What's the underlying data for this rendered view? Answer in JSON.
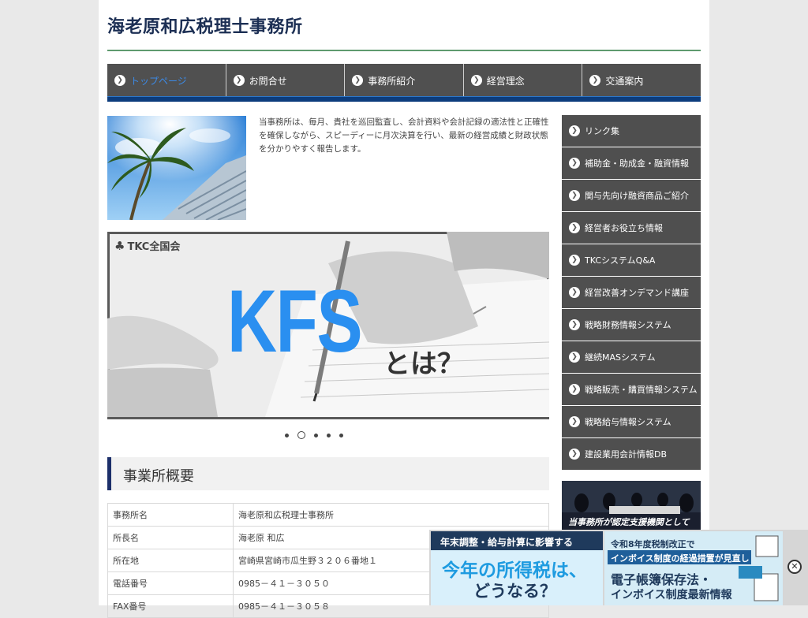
{
  "site": {
    "title": "海老原和広税理士事務所"
  },
  "nav": [
    {
      "label": "トップページ"
    },
    {
      "label": "お問合せ"
    },
    {
      "label": "事務所紹介"
    },
    {
      "label": "経営理念"
    },
    {
      "label": "交通案内"
    }
  ],
  "intro": "当事務所は、毎月、貴社を巡回監査し、会計資料や会計記録の適法性と正確性を確保しながら、スピーディーに月次決算を行い、最新の経営成績と財政状態を分かりやすく報告します。",
  "slider": {
    "logo": "TKC全国会",
    "headline": "KFS",
    "tagline": "とは？",
    "dots": 5,
    "active_dot": 2
  },
  "overview": {
    "title": "事業所概要",
    "rows": [
      {
        "label": "事務所名",
        "value": "海老原和広税理士事務所"
      },
      {
        "label": "所長名",
        "value": "海老原 和広"
      },
      {
        "label": "所在地",
        "value": "宮崎県宮崎市瓜生野３２０６番地１"
      },
      {
        "label": "電話番号",
        "value": "0985－４１－３０５０"
      },
      {
        "label": "FAX番号",
        "value": "0985－４１－３０５８"
      }
    ]
  },
  "sidebar": [
    {
      "label": "リンク集"
    },
    {
      "label": "補助金・助成金・融資情報"
    },
    {
      "label": "関与先向け融資商品ご紹介"
    },
    {
      "label": "経営者お役立ち情報"
    },
    {
      "label": "TKCシステムQ&A"
    },
    {
      "label": "経営改善オンデマンド講座"
    },
    {
      "label": "戦略財務情報システム"
    },
    {
      "label": "継続MASシステム"
    },
    {
      "label": "戦略販売・購買情報システム"
    },
    {
      "label": "戦略給与情報システム"
    },
    {
      "label": "建設業用会計情報DB"
    }
  ],
  "side_banner": {
    "caption": "当事務所が認定支援機関として"
  },
  "ads": {
    "left": {
      "line1": "年末調整・給与計算に影響する",
      "line2": "今年の所得税は、",
      "line3": "どうなる？"
    },
    "right": {
      "line1": "令和8年度税制改正で",
      "line2": "インボイス制度の経過措置が見直し",
      "line3": "電子帳簿保存法・",
      "line4": "インボイス制度最新情報"
    }
  },
  "colors": {
    "nav_bg": "#505050",
    "nav_accent": "#0c3c7c",
    "title": "#1c2f54",
    "active": "#3c8ae6",
    "kfs_blue": "#2a8ff0"
  },
  "icons": {
    "nav_arrow": "chevron-right-circle-icon",
    "close": "close-circle-icon"
  }
}
